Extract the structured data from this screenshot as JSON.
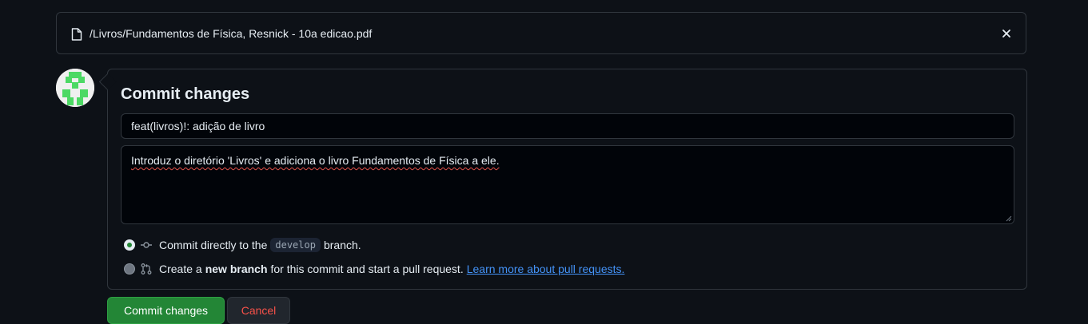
{
  "file_bar": {
    "path": "/Livros/Fundamentos de Física, Resnick - 10a edicao.pdf"
  },
  "commit": {
    "title": "Commit changes",
    "summary_value": "feat(livros)!: adição de livro",
    "description_value": "Introduz o diretório 'Livros' e adiciona o livro Fundamentos de Física a ele.",
    "option_direct": {
      "prefix": "Commit directly to the",
      "branch": "develop",
      "suffix": "branch."
    },
    "option_new_branch": {
      "prefix": "Create a",
      "bold": "new branch",
      "suffix": "for this commit and start a pull request.",
      "link": "Learn more about pull requests."
    }
  },
  "buttons": {
    "commit_label": "Commit changes",
    "cancel_label": "Cancel"
  },
  "colors": {
    "primary_green": "#238636",
    "cancel_red": "#f85149",
    "link_blue": "#4493f8",
    "background": "#0d1117"
  }
}
